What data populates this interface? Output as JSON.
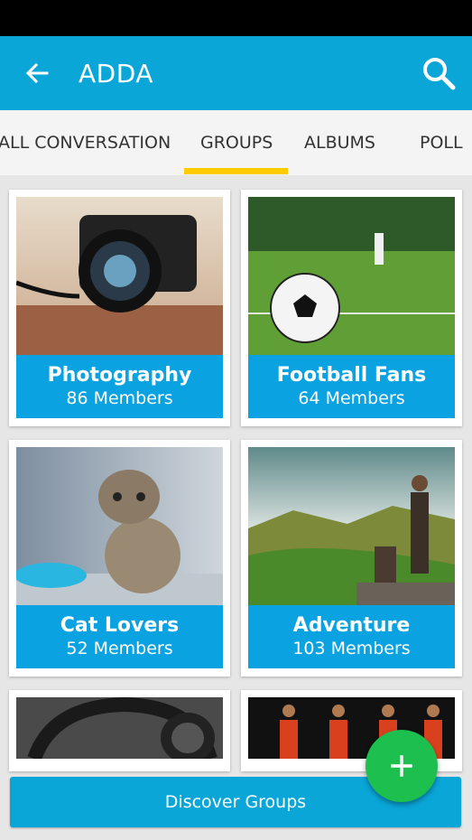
{
  "appbar": {
    "title": "ADDA",
    "back_icon": "arrow-left-icon",
    "search_icon": "search-icon"
  },
  "tabs": [
    {
      "label": "ALL CONVERSATION"
    },
    {
      "label": "GROUPS",
      "selected": true
    },
    {
      "label": "ALBUMS"
    },
    {
      "label": "POLL"
    }
  ],
  "groups": [
    {
      "name": "Photography",
      "members": "86 Members"
    },
    {
      "name": "Football Fans",
      "members": "64 Members"
    },
    {
      "name": "Cat Lovers",
      "members": "52 Members"
    },
    {
      "name": "Adventure",
      "members": "103 Members"
    }
  ],
  "discover_button": "Discover Groups",
  "fab_icon": "plus-icon",
  "colors": {
    "accent": "#0aa6d8",
    "tab_indicator": "#ffcc00",
    "fab": "#1dbf4e"
  }
}
